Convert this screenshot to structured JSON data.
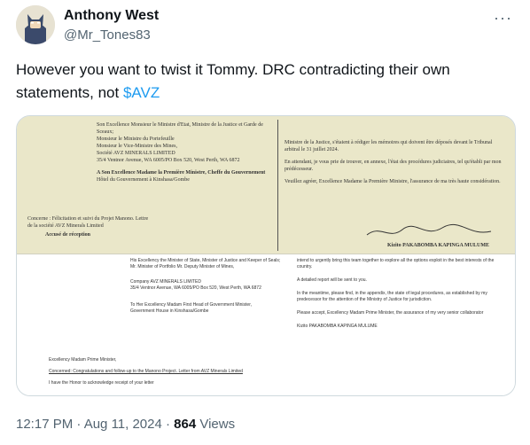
{
  "author": {
    "name": "Anthony West",
    "handle": "@Mr_Tones83"
  },
  "tweet": {
    "text_before": "However you want to twist it Tommy. DRC contradicting their own statements, not ",
    "cashtag": "$AVZ"
  },
  "media": {
    "doc_left_lines": [
      "Son Excellence Monsieur le Ministre d'Etat, Ministre de la Justice et Garde de Sceaux;",
      "Monsieur le Ministre du Portefeuille",
      "Monsieur le Vice-Ministre des Mines,",
      "Société AVZ MINERALS LIMITED",
      "35/4 Ventnor Avenue, WA 6005/PO Box 520, West Perth, WA 6872",
      "A Son Excellence Madame la Première Ministre, Cheffe du Gouvernement",
      "Hôtel du Gouvernement à Kinshasa/Gombe"
    ],
    "doc_concerne": "Concerne : Félicitation et suivi du Projet Manono. Lettre de la société AVZ Minerals Limited",
    "doc_accuse": "Accusé de réception",
    "doc_right_lines": [
      "Ministre de la Justice, s'étaient à rédiger les mémoires qui doivent être déposés devant le Tribunal arbitral le 31 juillet 2024.",
      "En attendant, je vous prie de trouver, en annexe, l'état des procédures judiciaires, tel qu'établi par mon prédécesseur.",
      "Veuillez agréer, Excellence Madame la Première Ministre, l'assurance de ma très haute considération."
    ],
    "doc_signature": "Kizito PAKABOMBA KAPINGA MULUME",
    "trans_left_lines": [
      "His Excellency the Minister of State, Minister of Justice and Keeper of Seals;",
      "Mr. Minister of Portfolio Mr. Deputy Minister of Mines,",
      "Company AVZ MINERALS LIMITED",
      "35/4 Ventnor Avenue, WA 6005/PO Box 520, West Perth, WA 6872",
      "To Her Excellency Madam First Head of Government Minister,",
      "Government House in Kinshasa/Gombe",
      "Excellency Madam Prime Minister,",
      "Concerned: Congratulations and follow-up to the Manono Project. Letter from AVZ Minerals Limited",
      "I have the Honor to acknowledge receipt of your letter"
    ],
    "trans_right_lines": [
      "intend to urgently bring this team together to explore all the options exploit in the best interests of the country.",
      "A detailed report will be sent to you.",
      "In the meantime, please find, in the appendix, the state of legal procedures, as established by my predecessor for the attention of the Ministry of Justice for jurisdiction.",
      "Please accept, Excellency Madam Prime Minister, the assurance of my very senior collaborator",
      "Kizito PAKABOMBA KAPINGA MULUME"
    ]
  },
  "footer": {
    "time": "12:17 PM · Aug 11, 2024 · ",
    "views_count": "864",
    "views_label": " Views"
  },
  "colors": {
    "cashtag": "#1d9bf0",
    "secondary_text": "#536471"
  }
}
